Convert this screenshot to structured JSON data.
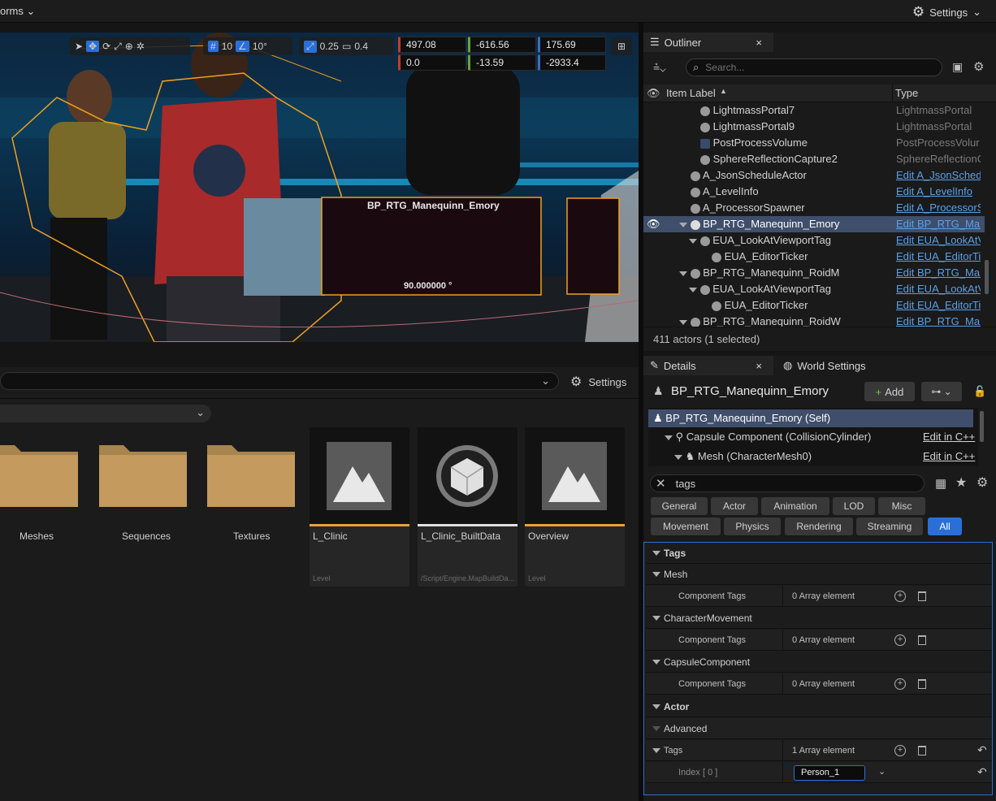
{
  "topbar": {
    "menu_label": "orms",
    "settings_label": "Settings"
  },
  "viewport": {
    "grid_snap": "10",
    "angle_snap": "10°",
    "scale_snap": "0.25",
    "camera_speed": "0.4",
    "location": [
      "497.08",
      "-616.56",
      "175.69"
    ],
    "rotation": [
      "0.0",
      "-13.59",
      "-2933.4"
    ],
    "hud_name": "BP_RTG_Manequinn_Emory",
    "hud_angle": "90.000000 °"
  },
  "outliner": {
    "tab_label": "Outliner",
    "search_placeholder": "Search...",
    "col_label": "Item Label",
    "col_type": "Type",
    "rows": [
      {
        "label": "LightmassPortal7",
        "type": "LightmassPortal",
        "link": false
      },
      {
        "label": "LightmassPortal9",
        "type": "LightmassPortal",
        "link": false
      },
      {
        "label": "PostProcessVolume",
        "type": "PostProcessVolur",
        "link": false
      },
      {
        "label": "SphereReflectionCapture2",
        "type": "SphereReflectionC",
        "link": false
      },
      {
        "label": "A_JsonScheduleActor",
        "type": "Edit A_JsonSched",
        "link": true
      },
      {
        "label": "A_LevelInfo",
        "type": "Edit A_LevelInfo",
        "link": true
      },
      {
        "label": "A_ProcessorSpawner",
        "type": "Edit A_ProcessorS",
        "link": true
      },
      {
        "label": "BP_RTG_Manequinn_Emory",
        "type": "Edit BP_RTG_Man",
        "link": true
      },
      {
        "label": "EUA_LookAtViewportTag",
        "type": "Edit EUA_LookAtV",
        "link": true
      },
      {
        "label": "EUA_EditorTicker",
        "type": "Edit EUA_EditorTic",
        "link": true
      },
      {
        "label": "BP_RTG_Manequinn_RoidM",
        "type": "Edit BP_RTG_Man",
        "link": true
      },
      {
        "label": "EUA_LookAtViewportTag",
        "type": "Edit EUA_LookAtV",
        "link": true
      },
      {
        "label": "EUA_EditorTicker",
        "type": "Edit EUA_EditorTic",
        "link": true
      },
      {
        "label": "BP_RTG_Manequinn_RoidW",
        "type": "Edit BP_RTG_Man",
        "link": true
      }
    ],
    "status": "411 actors (1 selected)"
  },
  "details": {
    "tab_label": "Details",
    "world_tab_label": "World Settings",
    "actor_name": "BP_RTG_Manequinn_Emory",
    "add_label": "Add",
    "components": [
      {
        "label": "BP_RTG_Manequinn_Emory (Self)",
        "edit": ""
      },
      {
        "label": "Capsule Component (CollisionCylinder)",
        "edit": "Edit in C++"
      },
      {
        "label": "Mesh (CharacterMesh0)",
        "edit": "Edit in C++"
      }
    ],
    "search_value": "tags",
    "filters_row1": [
      "General",
      "Actor",
      "Animation",
      "LOD",
      "Misc"
    ],
    "filters_row2": [
      "Movement",
      "Physics",
      "Rendering",
      "Streaming",
      "All"
    ],
    "section_tags": "Tags",
    "mesh": "Mesh",
    "component_tags": "Component Tags",
    "zero_elements": "0 Array element",
    "character_movement": "CharacterMovement",
    "capsule_component": "CapsuleComponent",
    "actor": "Actor",
    "advanced": "Advanced",
    "tags_label": "Tags",
    "one_element": "1 Array element",
    "index_label": "Index [ 0 ]",
    "index_value": "Person_1"
  },
  "content_browser": {
    "settings_label": "Settings",
    "folders": [
      "Meshes",
      "Sequences",
      "Textures"
    ],
    "assets": [
      {
        "name": "L_Clinic",
        "type": "Level"
      },
      {
        "name": "L_Clinic_BuiltData",
        "type": "/Script/Engine.MapBuildDa..."
      },
      {
        "name": "Overview",
        "type": "Level"
      }
    ]
  },
  "colors": {
    "accent": "#2a6fd8",
    "selection": "#3f4e6a",
    "asset_bar": "#e8a23a",
    "link": "#5aa0e6"
  }
}
